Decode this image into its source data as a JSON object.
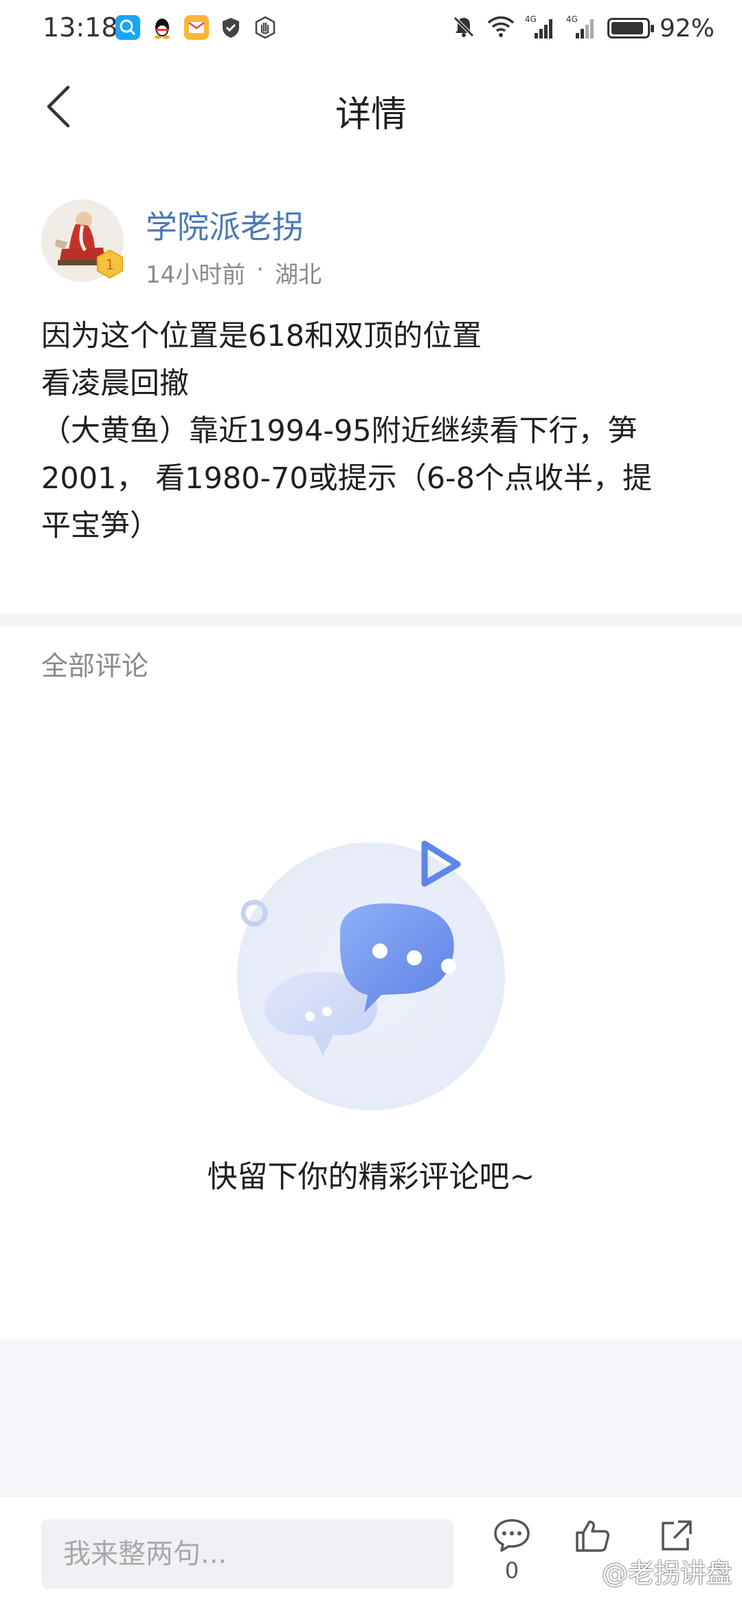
{
  "status_bar": {
    "time": "13:18",
    "battery": "92%",
    "battery_level": 0.92,
    "app_icons": [
      "search-app-icon",
      "qq-icon",
      "mail-app-icon",
      "shield-app-icon",
      "hand-app-icon"
    ],
    "right_icons": [
      "mute-icon",
      "wifi-icon",
      "4g-signal-icon",
      "4g-signal-icon"
    ]
  },
  "header": {
    "title": "详情"
  },
  "author": {
    "name": "学院派老拐",
    "time": "14小时前",
    "separator": "·",
    "location": "湖北",
    "level": "1"
  },
  "post": {
    "lines": [
      "因为这个位置是618和双顶的位置",
      "看凌晨回撤",
      "（大黄鱼）靠近1994-95附近继续看下行，笋",
      "2001， 看1980-70或提示（6-8个点收半，提",
      "平宝笋）"
    ]
  },
  "comments": {
    "label": "全部评论",
    "empty_text": "快留下你的精彩评论吧~"
  },
  "bottom_bar": {
    "input_placeholder": "我来整两句...",
    "comment_count": "0",
    "watermark": "@老拐讲盘"
  },
  "colors": {
    "accent": "#4a78b8",
    "bubble_blue": "#6f95ee",
    "divider": "#f3f4f7"
  }
}
